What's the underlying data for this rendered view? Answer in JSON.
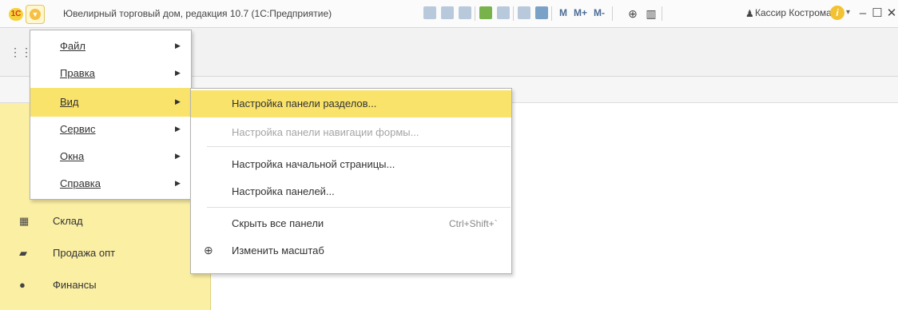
{
  "window": {
    "title": "Ювелирный торговый дом, редакция 10.7  (1С:Предприятие)",
    "logo_text": "1С",
    "user": "Кассир Кострома",
    "toolbar_m_labels": [
      "M",
      "M+",
      "M-"
    ]
  },
  "sidebar": {
    "items": [
      {
        "label": "Склад",
        "icon": "warehouse-icon"
      },
      {
        "label": "Продажа опт",
        "icon": "bag-icon"
      },
      {
        "label": "Финансы",
        "icon": "ruble-icon"
      }
    ]
  },
  "main_menu": {
    "items": [
      {
        "label": "Файл"
      },
      {
        "label": "Правка"
      },
      {
        "label": "Вид",
        "active": true
      },
      {
        "label": "Сервис"
      },
      {
        "label": "Окна"
      },
      {
        "label": "Справка"
      }
    ]
  },
  "view_submenu": {
    "items": [
      {
        "label": "Настройка панели разделов...",
        "active": true
      },
      {
        "label": "Настройка панели навигации формы...",
        "disabled": true
      },
      {
        "label": "Настройка начальной страницы..."
      },
      {
        "label": "Настройка панелей..."
      },
      {
        "label": "Скрыть все панели",
        "shortcut": "Ctrl+Shift+`"
      },
      {
        "label": "Изменить масштаб",
        "icon": "zoom-icon"
      }
    ]
  },
  "colors": {
    "accent_yellow": "#f9e36b",
    "sidebar_bg": "#fbefa4"
  }
}
